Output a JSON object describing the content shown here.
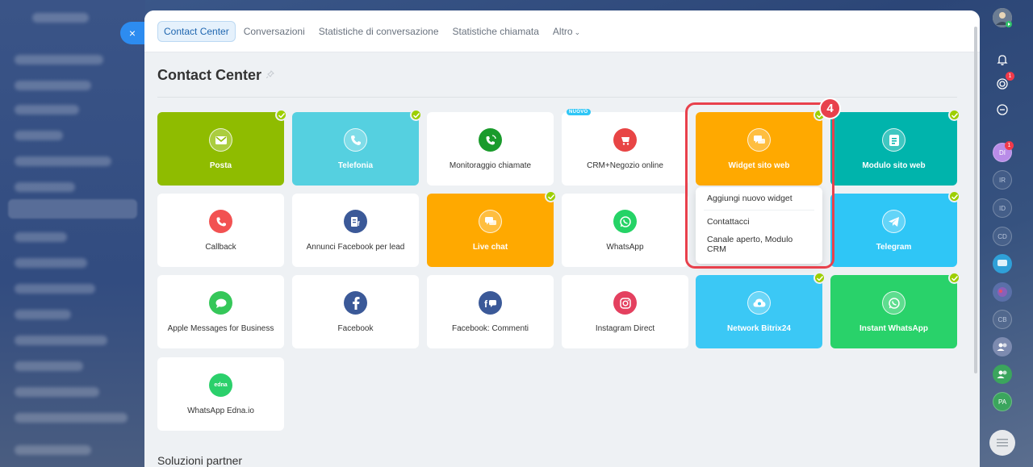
{
  "window": {
    "close_label": "×"
  },
  "tabs": [
    {
      "label": "Contact Center",
      "active": true
    },
    {
      "label": "Conversazioni"
    },
    {
      "label": "Statistiche di conversazione"
    },
    {
      "label": "Statistiche chiamata"
    },
    {
      "label": "Altro",
      "chevron": "⌄"
    }
  ],
  "page": {
    "title": "Contact Center",
    "pin_icon": "pin-icon"
  },
  "tiles": [
    {
      "label": "Posta",
      "color": "#8fbc00",
      "icon": "mail-icon",
      "checked": true
    },
    {
      "label": "Telefonia",
      "color": "#55d0e0",
      "icon": "phone-icon",
      "checked": true
    },
    {
      "label": "Monitoraggio chiamate",
      "color": "#ffffff",
      "icon": "phone-tracker-icon",
      "icon_color": "#1a9b2c"
    },
    {
      "label": "CRM+Negozio online",
      "color": "#ffffff",
      "icon": "shop-icon",
      "icon_color": "#e84545",
      "badge": "NUOVO"
    },
    {
      "label": "Widget sito web",
      "color": "#ffa900",
      "icon": "chat-icon",
      "checked": true
    },
    {
      "label": "Modulo sito web",
      "color": "#00b4ac",
      "icon": "form-icon",
      "checked": true
    },
    {
      "label": "Callback",
      "color": "#ffffff",
      "icon": "callback-icon",
      "icon_color": "#f25252"
    },
    {
      "label": "Annunci Facebook per lead",
      "color": "#ffffff",
      "icon": "facebook-lead-icon",
      "icon_color": "#3b5998"
    },
    {
      "label": "Live chat",
      "color": "#ffa900",
      "icon": "live-chat-icon",
      "checked": true
    },
    {
      "label": "WhatsApp",
      "color": "#ffffff",
      "icon": "whatsapp-icon",
      "icon_color": "#25d366"
    },
    {
      "label": "Telegram",
      "color": "#2fc6f6",
      "icon": "telegram-icon",
      "checked": true
    },
    {
      "label": "Apple Messages for Business",
      "color": "#ffffff",
      "icon": "apple-messages-icon",
      "icon_color": "#35c759"
    },
    {
      "label": "Facebook",
      "color": "#ffffff",
      "icon": "facebook-icon",
      "icon_color": "#3b5998"
    },
    {
      "label": "Facebook: Commenti",
      "color": "#ffffff",
      "icon": "facebook-comments-icon",
      "icon_color": "#3b5998"
    },
    {
      "label": "Instagram Direct",
      "color": "#ffffff",
      "icon": "instagram-icon",
      "icon_color": "#e4405f"
    },
    {
      "label": "Network Bitrix24",
      "color": "#3bc8f5",
      "icon": "cloud-icon",
      "checked": true
    },
    {
      "label": "Instant WhatsApp",
      "color": "#29d26a",
      "icon": "whatsapp-icon",
      "checked": true
    },
    {
      "label": "WhatsApp Edna.io",
      "color": "#ffffff",
      "icon": "edna-icon",
      "icon_color": "#2bd06b",
      "icon_text": "edna"
    }
  ],
  "popup": {
    "items": [
      "Aggiungi nuovo widget",
      "Contattacci",
      "Canale aperto, Modulo CRM"
    ]
  },
  "step_number": "4",
  "partners": {
    "title": "Soluzioni partner"
  },
  "right_sidebar": {
    "notification_counter": "1",
    "avatar_counter": "1",
    "avatars": [
      "DI",
      "IR",
      "ID",
      "CD",
      "CB",
      "PA"
    ]
  }
}
